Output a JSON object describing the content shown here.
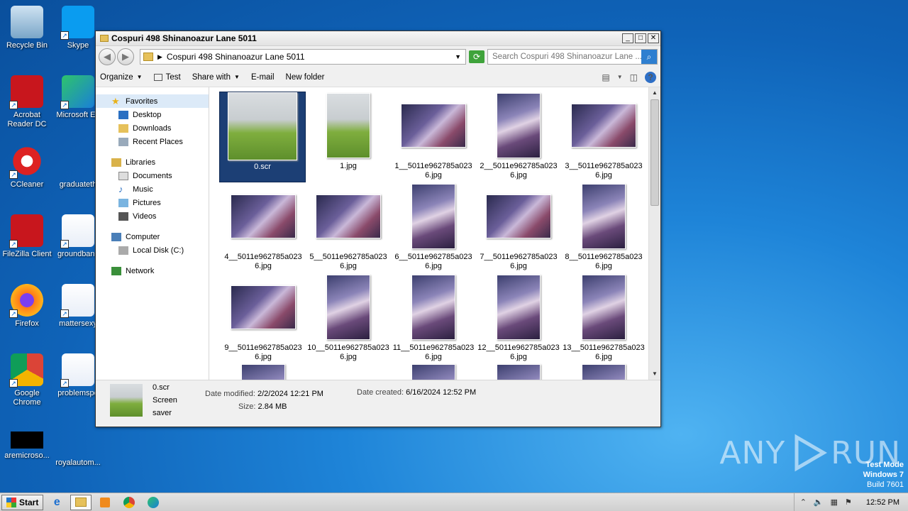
{
  "desktop": {
    "icons": [
      {
        "label": "Recycle Bin",
        "icon": "recycle-bin-icon"
      },
      {
        "label": "Skype",
        "icon": "skype-icon"
      },
      {
        "label": "Acrobat Reader DC",
        "icon": "acrobat-icon"
      },
      {
        "label": "Microsoft Ed",
        "icon": "edge-icon"
      },
      {
        "label": "CCleaner",
        "icon": "ccleaner-icon"
      },
      {
        "label": "graduateth",
        "icon": "blank-icon"
      },
      {
        "label": "FileZilla Client",
        "icon": "filezilla-icon"
      },
      {
        "label": "groundbanc",
        "icon": "word-doc-icon"
      },
      {
        "label": "Firefox",
        "icon": "firefox-icon"
      },
      {
        "label": "mattersexy",
        "icon": "word-doc-icon"
      },
      {
        "label": "Google Chrome",
        "icon": "chrome-icon"
      },
      {
        "label": "problemspe",
        "icon": "word-doc-icon"
      },
      {
        "label": "aremicroso...",
        "icon": "black-file-icon"
      },
      {
        "label": "royalautom...",
        "icon": "blank-icon"
      }
    ]
  },
  "window": {
    "title": "Cospuri 498 Shinanoazur Lane 5011",
    "address_path": "Cospuri 498 Shinanoazur Lane 5011",
    "search_placeholder": "Search Cospuri 498 Shinanoazur Lane ...",
    "toolbar": {
      "organize": "Organize",
      "test": "Test",
      "share_with": "Share with",
      "email": "E-mail",
      "new_folder": "New folder"
    },
    "nav": {
      "favorites": "Favorites",
      "desktop": "Desktop",
      "downloads": "Downloads",
      "recent_places": "Recent Places",
      "libraries": "Libraries",
      "documents": "Documents",
      "music": "Music",
      "pictures": "Pictures",
      "videos": "Videos",
      "computer": "Computer",
      "local_disk": "Local Disk (C:)",
      "network": "Network"
    },
    "files": [
      {
        "name": "0.scr",
        "orientation": "sel",
        "style": "green",
        "selected": true
      },
      {
        "name": "1.jpg",
        "orientation": "tall",
        "style": "green",
        "selected": false
      },
      {
        "name": "1__5011e962785a0236.jpg",
        "orientation": "wide",
        "style": "cos",
        "selected": false
      },
      {
        "name": "2__5011e962785a0236.jpg",
        "orientation": "tall",
        "style": "cos2",
        "selected": false
      },
      {
        "name": "3__5011e962785a0236.jpg",
        "orientation": "wide",
        "style": "cos",
        "selected": false
      },
      {
        "name": "4__5011e962785a0236.jpg",
        "orientation": "wide",
        "style": "cos",
        "selected": false
      },
      {
        "name": "5__5011e962785a0236.jpg",
        "orientation": "wide",
        "style": "cos",
        "selected": false
      },
      {
        "name": "6__5011e962785a0236.jpg",
        "orientation": "tall",
        "style": "cos2",
        "selected": false
      },
      {
        "name": "7__5011e962785a0236.jpg",
        "orientation": "wide",
        "style": "cos",
        "selected": false
      },
      {
        "name": "8__5011e962785a0236.jpg",
        "orientation": "tall",
        "style": "cos2",
        "selected": false
      },
      {
        "name": "9__5011e962785a0236.jpg",
        "orientation": "wide",
        "style": "cos",
        "selected": false
      },
      {
        "name": "10__5011e962785a0236.jpg",
        "orientation": "tall",
        "style": "cos2",
        "selected": false
      },
      {
        "name": "11__5011e962785a0236.jpg",
        "orientation": "tall",
        "style": "cos2",
        "selected": false
      },
      {
        "name": "12__5011e962785a0236.jpg",
        "orientation": "tall",
        "style": "cos2",
        "selected": false
      },
      {
        "name": "13__5011e962785a0236.jpg",
        "orientation": "tall",
        "style": "cos2",
        "selected": false
      }
    ],
    "details": {
      "name": "0.scr",
      "type": "Screen saver",
      "date_modified_label": "Date modified:",
      "date_modified": "2/2/2024 12:21 PM",
      "size_label": "Size:",
      "size": "2.84 MB",
      "date_created_label": "Date created:",
      "date_created": "6/16/2024 12:52 PM"
    }
  },
  "taskbar": {
    "start": "Start",
    "clock": "12:52 PM"
  },
  "watermark": {
    "left": "ANY",
    "right": "RUN"
  },
  "test_mode": {
    "line1": "Test Mode",
    "line2": "Windows 7",
    "line3": "Build 7601"
  }
}
